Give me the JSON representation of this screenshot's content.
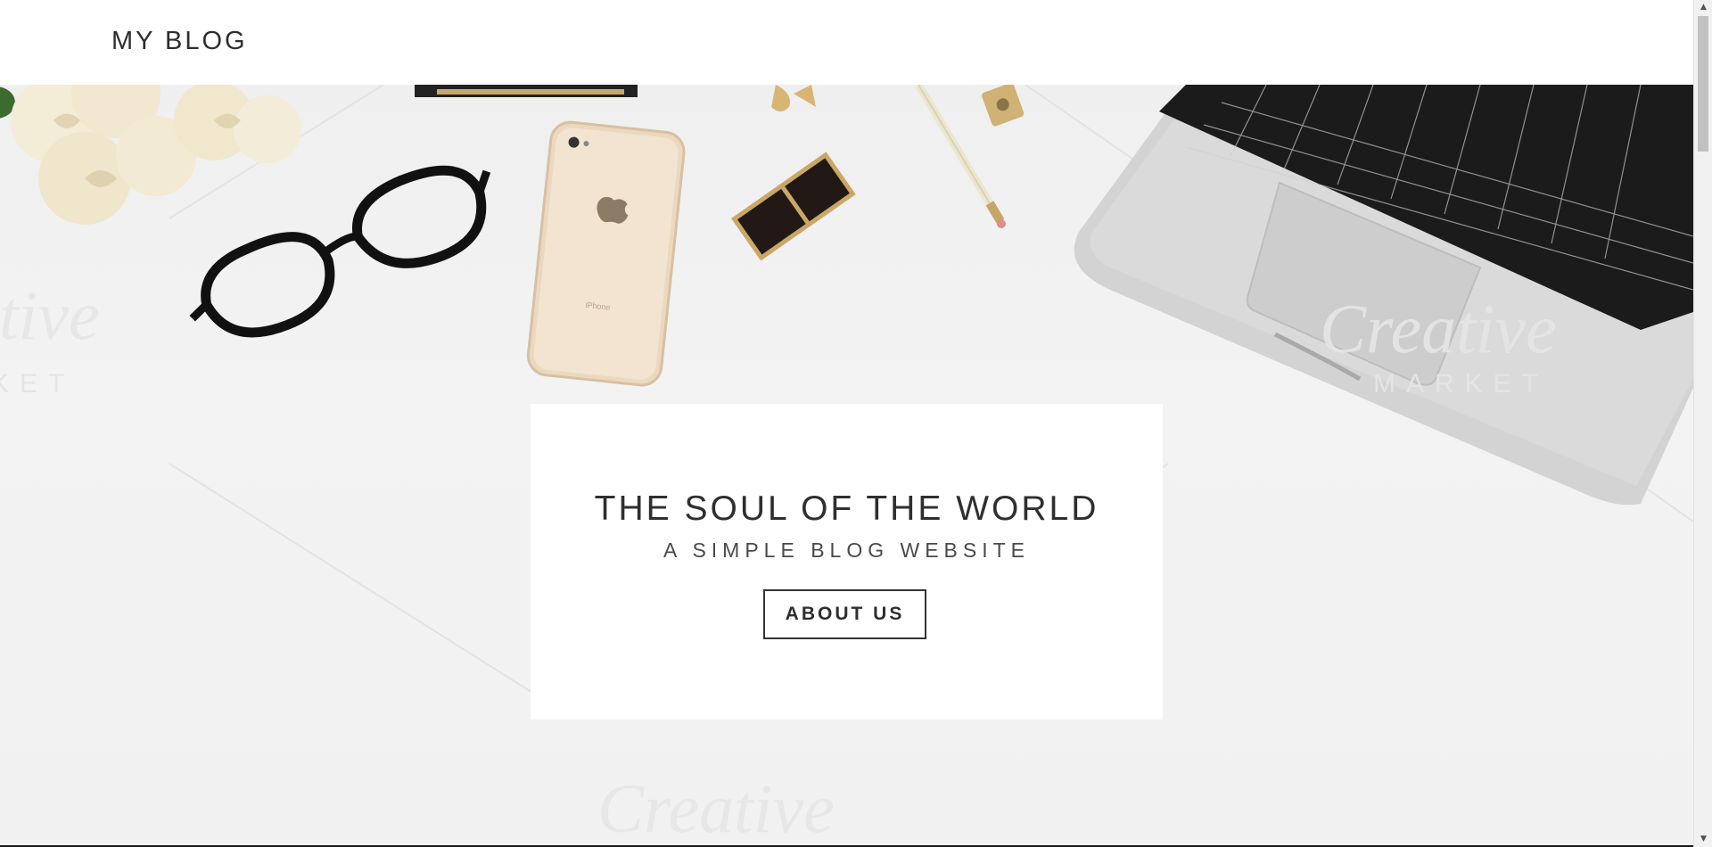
{
  "header": {
    "logo": "MY BLOG"
  },
  "hero": {
    "title": "THE SOUL OF THE WORLD",
    "subtitle": "A SIMPLE BLOG WEBSITE",
    "button_label": "ABOUT US"
  },
  "scrollbar": {
    "up_arrow": "▲",
    "down_arrow": "▼"
  },
  "colors": {
    "text": "#2e2e2e",
    "background": "#f1f1f1",
    "card": "#ffffff"
  },
  "icons": [
    "glasses",
    "phone",
    "lipstick",
    "pencil",
    "sharpener",
    "laptop",
    "roses"
  ]
}
